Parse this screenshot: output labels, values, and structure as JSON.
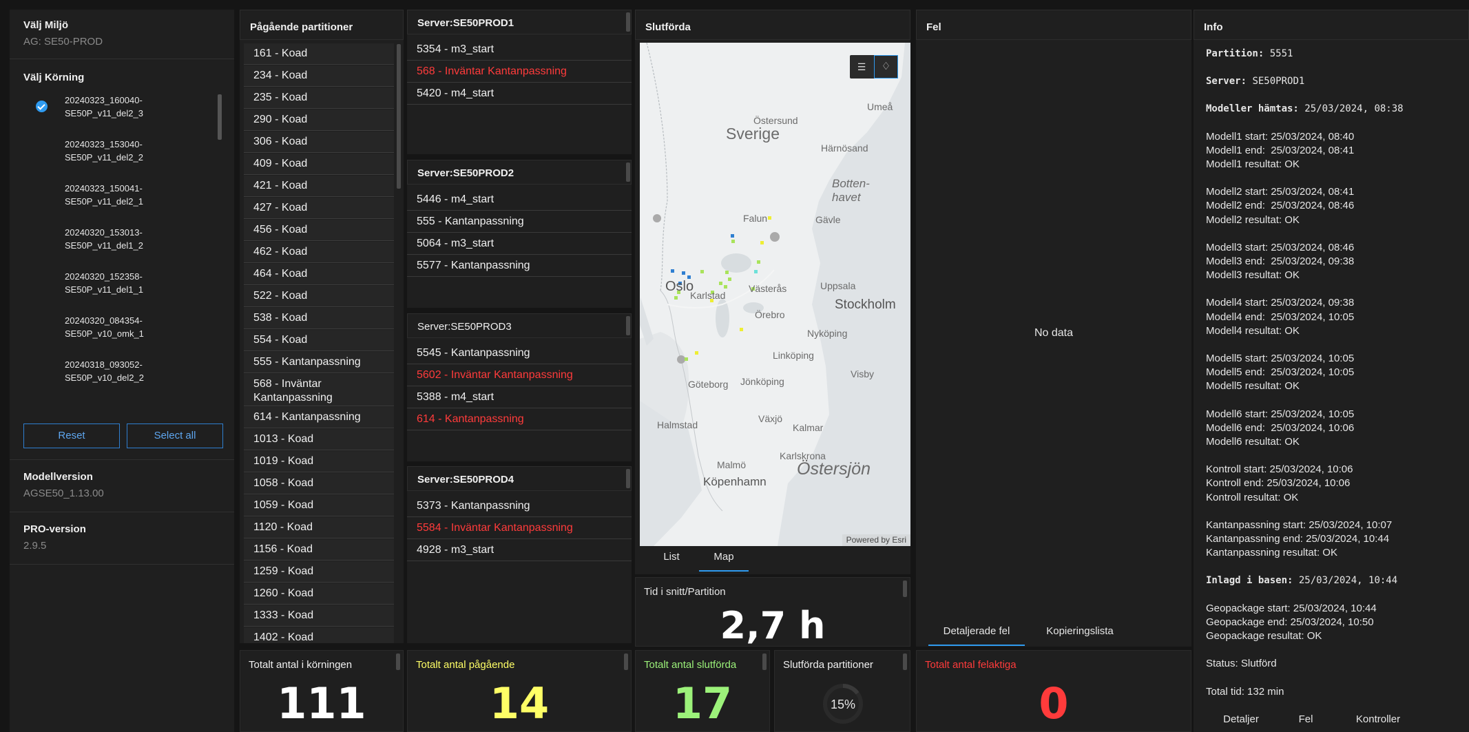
{
  "sidebar": {
    "env_label": "Välj Miljö",
    "env_value": "AG: SE50-PROD",
    "run_label": "Välj Körning",
    "runs": [
      {
        "line1": "20240323_160040-",
        "line2": "SE50P_v11_del2_3",
        "selected": true
      },
      {
        "line1": "20240323_153040-",
        "line2": "SE50P_v11_del2_2",
        "selected": false
      },
      {
        "line1": "20240323_150041-",
        "line2": "SE50P_v11_del2_1",
        "selected": false
      },
      {
        "line1": "20240320_153013-",
        "line2": "SE50P_v11_del1_2",
        "selected": false
      },
      {
        "line1": "20240320_152358-",
        "line2": "SE50P_v11_del1_1",
        "selected": false
      },
      {
        "line1": "20240320_084354-",
        "line2": "SE50P_v10_omk_1",
        "selected": false
      },
      {
        "line1": "20240318_093052-",
        "line2": "SE50P_v10_del2_2",
        "selected": false
      }
    ],
    "reset_label": "Reset",
    "select_all_label": "Select all",
    "model_version_label": "Modellversion",
    "model_version_value": "AGSE50_1.13.00",
    "pro_version_label": "PRO-version",
    "pro_version_value": "2.9.5"
  },
  "ongoing": {
    "title": "Pågående partitioner",
    "items": [
      "161 - Koad",
      "234 - Koad",
      "235 - Koad",
      "290 - Koad",
      "306 - Koad",
      "409 - Koad",
      "421 - Koad",
      "427 - Koad",
      "456 - Koad",
      "462 - Koad",
      "464 - Koad",
      "522 - Koad",
      "538 - Koad",
      "554 - Koad",
      "555 - Kantanpassning",
      "568 - Inväntar Kantanpassning",
      "614 - Kantanpassning",
      "1013 - Koad",
      "1019 - Koad",
      "1058 - Koad",
      "1059 - Koad",
      "1120 - Koad",
      "1156 - Koad",
      "1259 - Koad",
      "1260 - Koad",
      "1333 - Koad",
      "1402 - Koad"
    ]
  },
  "servers": [
    {
      "title": "Server:SE50PROD1",
      "items": [
        {
          "text": "5354 - m3_start",
          "red": false
        },
        {
          "text": "568 - Inväntar Kantanpassning",
          "red": true
        },
        {
          "text": "5420 - m4_start",
          "red": false
        }
      ]
    },
    {
      "title": "Server:SE50PROD2",
      "items": [
        {
          "text": "5446 - m4_start",
          "red": false
        },
        {
          "text": "555 - Kantanpassning",
          "red": false
        },
        {
          "text": "5064 - m3_start",
          "red": false
        },
        {
          "text": "5577 - Kantanpassning",
          "red": false
        }
      ]
    },
    {
      "title": "Server:SE50PROD3",
      "items": [
        {
          "text": "5545 - Kantanpassning",
          "red": false
        },
        {
          "text": "5602 - Inväntar Kantanpassning",
          "red": true
        },
        {
          "text": "5388 - m4_start",
          "red": false
        },
        {
          "text": "614 - Kantanpassning",
          "red": true
        }
      ]
    },
    {
      "title": "Server:SE50PROD4",
      "items": [
        {
          "text": "5373 - Kantanpassning",
          "red": false
        },
        {
          "text": "5584 - Inväntar Kantanpassning",
          "red": true
        },
        {
          "text": "4928 - m3_start",
          "red": false
        }
      ]
    }
  ],
  "completed": {
    "title": "Slutförda",
    "tab_list": "List",
    "tab_map": "Map",
    "powered_by": "Powered by Esri",
    "map_labels": {
      "sverige": "Sverige",
      "ostersund": "Östersund",
      "umea": "Umeå",
      "harnosand": "Härnösand",
      "bottenhavet1": "Botten-",
      "bottenhavet2": "havet",
      "falun": "Falun",
      "gavle": "Gävle",
      "oslo": "Oslo",
      "karlstad": "Karlstad",
      "vasteras": "Västerås",
      "uppsala": "Uppsala",
      "stockholm": "Stockholm",
      "orebro": "Örebro",
      "nykoping": "Nyköping",
      "linkoping": "Linköping",
      "goteborg": "Göteborg",
      "jonkoping": "Jönköping",
      "visby": "Visby",
      "vaxjo": "Växjö",
      "halmstad": "Halmstad",
      "kalmar": "Kalmar",
      "karlskrona": "Karlskrona",
      "malmo": "Malmö",
      "kopenhamn": "Köpenhamn",
      "ostersjon": "Östersjön"
    }
  },
  "avg_time": {
    "label": "Tid i snitt/Partition",
    "value": "2,7 h"
  },
  "errors": {
    "title": "Fel",
    "empty": "No data",
    "tab_detailed": "Detaljerade fel",
    "tab_copy": "Kopieringslista"
  },
  "info": {
    "title": "Info",
    "lines": [
      {
        "k": "Partition:",
        "v": "5551",
        "mono": true
      },
      {
        "k": "",
        "v": "",
        "gap": true
      },
      {
        "k": "Server:",
        "v": "SE50PROD1",
        "mono": true
      },
      {
        "k": "",
        "v": "",
        "gap": true
      },
      {
        "k": "Modeller hämtas:",
        "v": "25/03/2024, 08:38",
        "mono": true
      },
      {
        "k": "",
        "v": "",
        "gap": true
      },
      {
        "k": "Modell1 start:",
        "v": "25/03/2024, 08:40"
      },
      {
        "k": "Modell1 end:",
        "v": " 25/03/2024, 08:41"
      },
      {
        "k": "Modell1 resultat:",
        "v": "OK"
      },
      {
        "k": "",
        "v": "",
        "gap": true
      },
      {
        "k": "Modell2 start:",
        "v": "25/03/2024, 08:41"
      },
      {
        "k": "Modell2 end:",
        "v": " 25/03/2024, 08:46"
      },
      {
        "k": "Modell2 resultat:",
        "v": "OK"
      },
      {
        "k": "",
        "v": "",
        "gap": true
      },
      {
        "k": "Modell3 start:",
        "v": "25/03/2024, 08:46"
      },
      {
        "k": "Modell3 end:",
        "v": " 25/03/2024, 09:38"
      },
      {
        "k": "Modell3 resultat:",
        "v": "OK"
      },
      {
        "k": "",
        "v": "",
        "gap": true
      },
      {
        "k": "Modell4 start:",
        "v": "25/03/2024, 09:38"
      },
      {
        "k": "Modell4 end:",
        "v": " 25/03/2024, 10:05"
      },
      {
        "k": "Modell4 resultat:",
        "v": "OK"
      },
      {
        "k": "",
        "v": "",
        "gap": true
      },
      {
        "k": "Modell5 start:",
        "v": "25/03/2024, 10:05"
      },
      {
        "k": "Modell5 end:",
        "v": " 25/03/2024, 10:05"
      },
      {
        "k": "Modell5 resultat:",
        "v": "OK"
      },
      {
        "k": "",
        "v": "",
        "gap": true
      },
      {
        "k": "Modell6 start:",
        "v": "25/03/2024, 10:05"
      },
      {
        "k": "Modell6 end:",
        "v": " 25/03/2024, 10:06"
      },
      {
        "k": "Modell6 resultat:",
        "v": "OK"
      },
      {
        "k": "",
        "v": "",
        "gap": true
      },
      {
        "k": "Kontroll start:",
        "v": "25/03/2024, 10:06"
      },
      {
        "k": "Kontroll end:",
        "v": "25/03/2024, 10:06"
      },
      {
        "k": "Kontroll resultat:",
        "v": "OK"
      },
      {
        "k": "",
        "v": "",
        "gap": true
      },
      {
        "k": "Kantanpassning start:",
        "v": "25/03/2024, 10:07"
      },
      {
        "k": "Kantanpassning end:",
        "v": "25/03/2024, 10:44"
      },
      {
        "k": "Kantanpassning resultat:",
        "v": "OK"
      },
      {
        "k": "",
        "v": "",
        "gap": true
      },
      {
        "k": "Inlagd i basen:",
        "v": "25/03/2024, 10:44",
        "mono": true
      },
      {
        "k": "",
        "v": "",
        "gap": true
      },
      {
        "k": "Geopackage start:",
        "v": "25/03/2024, 10:44"
      },
      {
        "k": "Geopackage end:",
        "v": "25/03/2024, 10:50"
      },
      {
        "k": "Geopackage resultat:",
        "v": "OK"
      },
      {
        "k": "",
        "v": "",
        "gap": true
      },
      {
        "k": "Status:",
        "v": "Slutförd"
      },
      {
        "k": "",
        "v": "",
        "gap": true
      },
      {
        "k": "Total tid:",
        "v": "132 min"
      }
    ],
    "tab_details": "Detaljer",
    "tab_errors": "Fel",
    "tab_controls": "Kontroller"
  },
  "stats": {
    "total_label": "Totalt antal i körningen",
    "total_value": "111",
    "ongoing_label": "Totalt antal pågående",
    "ongoing_value": "14",
    "completed_label": "Totalt antal slutförda",
    "completed_value": "17",
    "pct_label": "Slutförda partitioner",
    "pct_value": "15%",
    "pct_fraction": 0.15,
    "failed_label": "Totalt antal felaktiga",
    "failed_value": "0"
  },
  "colors": {
    "accent": "#2f9bf0",
    "red": "#ff3b3b",
    "yellow": "#ffff66",
    "green": "#9cf27a",
    "white": "#ffffff"
  }
}
